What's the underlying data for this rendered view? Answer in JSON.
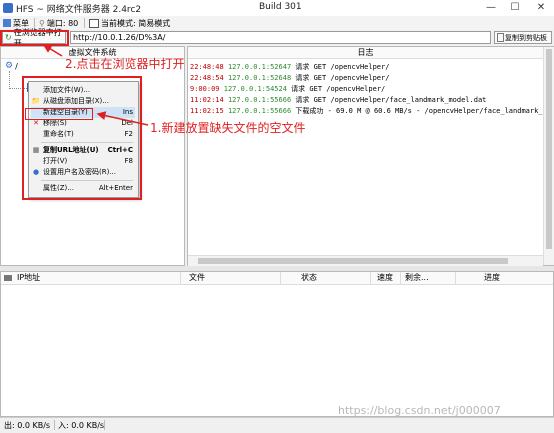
{
  "window": {
    "title": "HFS ~ 网络文件服务器 2.4rc2",
    "build": "Build 301",
    "controls": [
      "—",
      "☐",
      "✕"
    ]
  },
  "toolbar": {
    "menu_label": "菜单",
    "port_label": "端口: 80",
    "mode_label": "当前模式: 简易模式"
  },
  "addressbar": {
    "open_browser_label": "在浏览器中打开",
    "url": "http://10.0.1.26/D%3A/",
    "copy_label": "复制到剪贴板"
  },
  "vfs": {
    "header": "虚拟文件系统",
    "root_label": "/"
  },
  "log": {
    "header": "日志",
    "lines": [
      {
        "time": "22:48:48",
        "ip": "127.0.0.1:52647",
        "msg": "请求 GET /opencvHelper/"
      },
      {
        "time": "22:48:54",
        "ip": "127.0.0.1:52648",
        "msg": "请求 GET /opencvHelper/"
      },
      {
        "time": "9:00:09",
        "ip": "127.0.0.1:54524",
        "msg": "请求 GET /opencvHelper/"
      },
      {
        "time": "11:02:14",
        "ip": "127.0.0.1:55666",
        "msg": "请求 GET /opencvHelper/face_landmark_model.dat"
      },
      {
        "time": "11:02:15",
        "ip": "127.0.0.1:55666",
        "msg": "下载成功 - 69.0 M @ 60.6 MB/s - /opencvHelper/face_landmark_"
      }
    ]
  },
  "context_menu": {
    "items": [
      {
        "icon": "",
        "label": "添加文件(W)...",
        "shortcut": ""
      },
      {
        "icon": "📁",
        "label": "从磁盘添加目录(X)...",
        "shortcut": ""
      },
      {
        "icon": "",
        "label": "新建空目录(Y)",
        "shortcut": "Ins"
      },
      {
        "icon": "✕",
        "label": "移除(S)",
        "shortcut": "Del"
      },
      {
        "icon": "",
        "label": "重命名(T)",
        "shortcut": "F2"
      },
      {
        "icon": "▦",
        "label": "复制URL地址(U)",
        "shortcut": "Ctrl+C"
      },
      {
        "icon": "",
        "label": "打开(V)",
        "shortcut": "F8"
      },
      {
        "icon": "●",
        "label": "设置用户名及密码(R)...",
        "shortcut": ""
      },
      {
        "icon": "",
        "label": "属性(Z)...",
        "shortcut": "Alt+Enter"
      }
    ]
  },
  "connections": {
    "columns": [
      "IP地址",
      "文件",
      "状态",
      "速度",
      "剩余...",
      "进度"
    ]
  },
  "statusbar": {
    "out_speed": "出: 0.0 KB/s",
    "in_speed": "入: 0.0 KB/s"
  },
  "annotations": {
    "step1": "1.新建放置缺失文件的空文件",
    "step2": "2.点击在浏览器中打开"
  },
  "watermark": "https://blog.csdn.net/j000007",
  "colors": {
    "annotation_red": "#e02020",
    "log_time": "#c00000",
    "log_ip": "#2c8a2c",
    "menu_highlight": "#cfe3f7"
  }
}
